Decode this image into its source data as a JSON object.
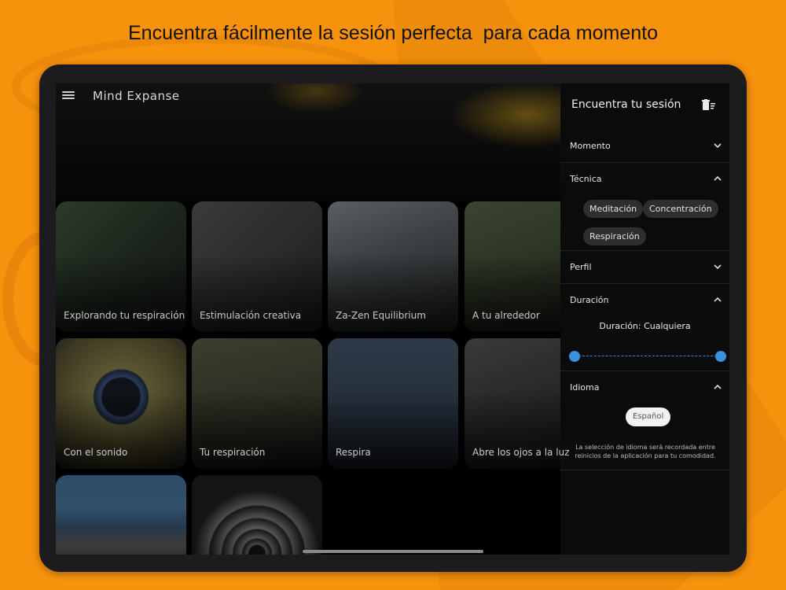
{
  "promo": {
    "title": "Encuentra fácilmente la sesión perfecta  para cada momento"
  },
  "colors": {
    "background": "#f7920d",
    "accent": "#3a8fe2",
    "panel": "#0b0b0b"
  },
  "app": {
    "menu_icon": "hamburger-menu-icon",
    "title": "Mind Expanse"
  },
  "sessions": [
    {
      "label": "Explorando tu respiración"
    },
    {
      "label": "Estimulación creativa"
    },
    {
      "label": "Za-Zen Equilibrium"
    },
    {
      "label": "A tu alrededor"
    },
    {
      "label": "Con el sonido"
    },
    {
      "label": "Tu respiración"
    },
    {
      "label": "Respira"
    },
    {
      "label": "Abre los ojos a la luz"
    },
    {
      "label": ""
    },
    {
      "label": ""
    }
  ],
  "filter_panel": {
    "title": "Encuentra tu sesión",
    "clear_icon": "clear-filters-icon",
    "sections": {
      "momento": {
        "label": "Momento",
        "expanded": false
      },
      "tecnica": {
        "label": "Técnica",
        "expanded": true,
        "chips": [
          "Meditación",
          "Concentración",
          "Respiración"
        ]
      },
      "perfil": {
        "label": "Perfil",
        "expanded": false
      },
      "duracion": {
        "label": "Duración",
        "expanded": true,
        "value_text": "Duración: Cualquiera",
        "range": [
          0,
          1
        ]
      },
      "idioma": {
        "label": "Idioma",
        "expanded": true,
        "selected_language": "Español",
        "note": "La selección de idioma será recordada entre reinicios de la aplicación para tu comodidad."
      }
    }
  }
}
